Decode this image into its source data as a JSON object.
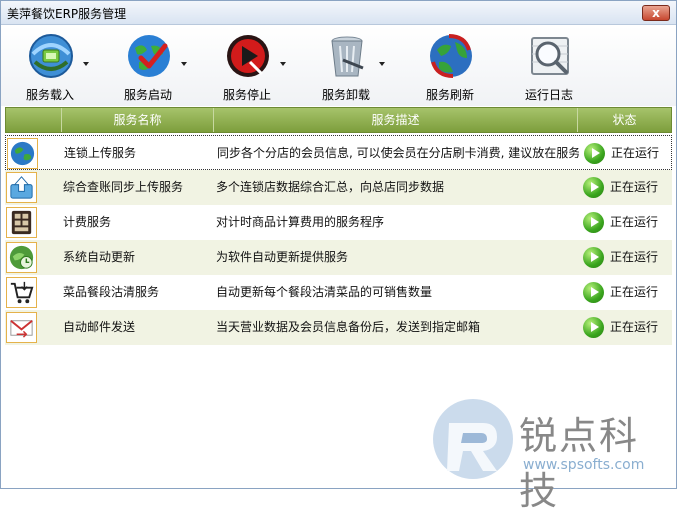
{
  "window": {
    "title": "美萍餐饮ERP服务管理",
    "close_label": "x"
  },
  "toolbar": [
    {
      "label": "服务载入",
      "icon": "load-service-icon"
    },
    {
      "label": "服务启动",
      "icon": "start-service-icon"
    },
    {
      "label": "服务停止",
      "icon": "stop-service-icon"
    },
    {
      "label": "服务卸载",
      "icon": "uninstall-service-icon"
    },
    {
      "label": "服务刷新",
      "icon": "refresh-service-icon"
    },
    {
      "label": "运行日志",
      "icon": "run-log-icon"
    }
  ],
  "grid": {
    "columns": [
      "服务名称",
      "服务描述",
      "状态"
    ],
    "rows": [
      {
        "icon": "globe-icon",
        "name": "连锁上传服务",
        "desc": "同步各个分店的会员信息, 可以使会员在分店刷卡消费, 建议放在服务",
        "status": "正在运行"
      },
      {
        "icon": "upload-icon",
        "name": "综合查账同步上传服务",
        "desc": "多个连锁店数据综合汇总，向总店同步数据",
        "status": "正在运行"
      },
      {
        "icon": "timer-icon",
        "name": "计费服务",
        "desc": "对计时商品计算费用的服务程序",
        "status": "正在运行"
      },
      {
        "icon": "update-globe-icon",
        "name": "系统自动更新",
        "desc": "为软件自动更新提供服务",
        "status": "正在运行"
      },
      {
        "icon": "cart-icon",
        "name": "菜品餐段沽清服务",
        "desc": "自动更新每个餐段沽清菜品的可销售数量",
        "status": "正在运行"
      },
      {
        "icon": "mail-icon",
        "name": "自动邮件发送",
        "desc": "当天营业数据及会员信息备份后，发送到指定邮箱",
        "status": "正在运行"
      }
    ]
  },
  "watermark": {
    "title": "锐点科技",
    "url": "www.spsofts.com"
  }
}
